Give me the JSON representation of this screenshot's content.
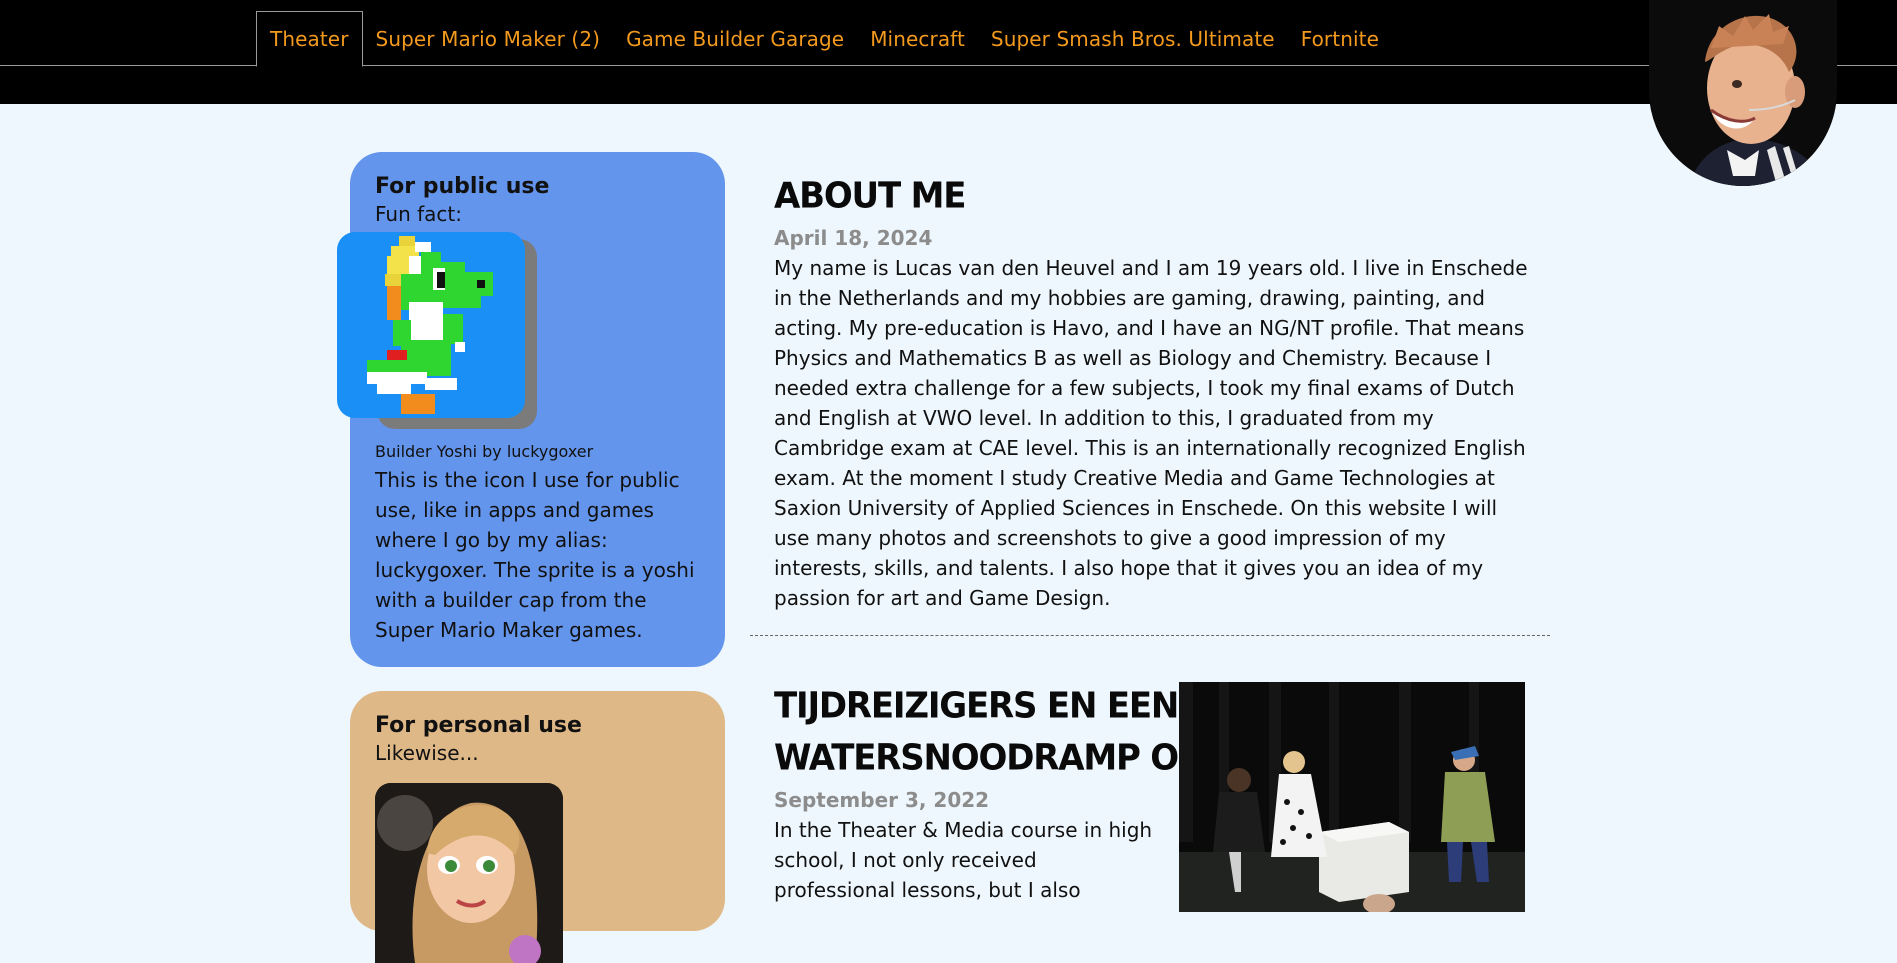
{
  "nav": {
    "tabs": [
      {
        "label": "Theater",
        "active": true
      },
      {
        "label": "Super Mario Maker (2)"
      },
      {
        "label": "Game Builder Garage"
      },
      {
        "label": "Minecraft"
      },
      {
        "label": "Super Smash Bros. Ultimate"
      },
      {
        "label": "Fortnite"
      }
    ]
  },
  "sidebar": {
    "public": {
      "heading": "For public use",
      "sub": "Fun fact:",
      "caption": "Builder Yoshi by luckygoxer",
      "description": "This is the icon I use for public use, like in apps and games where I go by my alias: luckygoxer. The sprite is a yoshi with a builder cap from the Super Mario Maker games."
    },
    "personal": {
      "heading": "For personal use",
      "sub": "Likewise..."
    }
  },
  "posts": [
    {
      "title": "About me",
      "date": "April 18, 2024",
      "body": "My name is Lucas van den Heuvel and I am 19 years old. I live in Enschede in the Netherlands and my hobbies are gaming, drawing, painting, and acting. My pre-education is Havo, and I have an NG/NT profile. That means Physics and Mathematics B as well as Biology and Chemistry. Because I needed extra challenge for a few subjects, I took my final exams of Dutch and English at VWO level. In addition to this, I graduated from my Cambridge exam at CAE level. This is an internationally recognized English exam. At the moment I study Creative Media and Game Technologies at Saxion University of Applied Sciences in Enschede. On this website I will use many photos and screenshots to give a good impression of my interests, skills, and talents. I also hope that it gives you an idea of my passion for art and Game Design."
    },
    {
      "title_line1": "Tijdreizigers en een",
      "title_line2": "watersnoodramp ofzo",
      "date": "September 3, 2022",
      "body": "In the Theater & Media course in high school, I not only received professional lessons, but I also"
    }
  ],
  "colors": {
    "accent": "#f39a1e",
    "nav_background": "#000000",
    "page_background": "#eef7fd",
    "public_card": "#6495ec",
    "personal_card": "#dfb887",
    "date_text": "#8c8c8c"
  }
}
